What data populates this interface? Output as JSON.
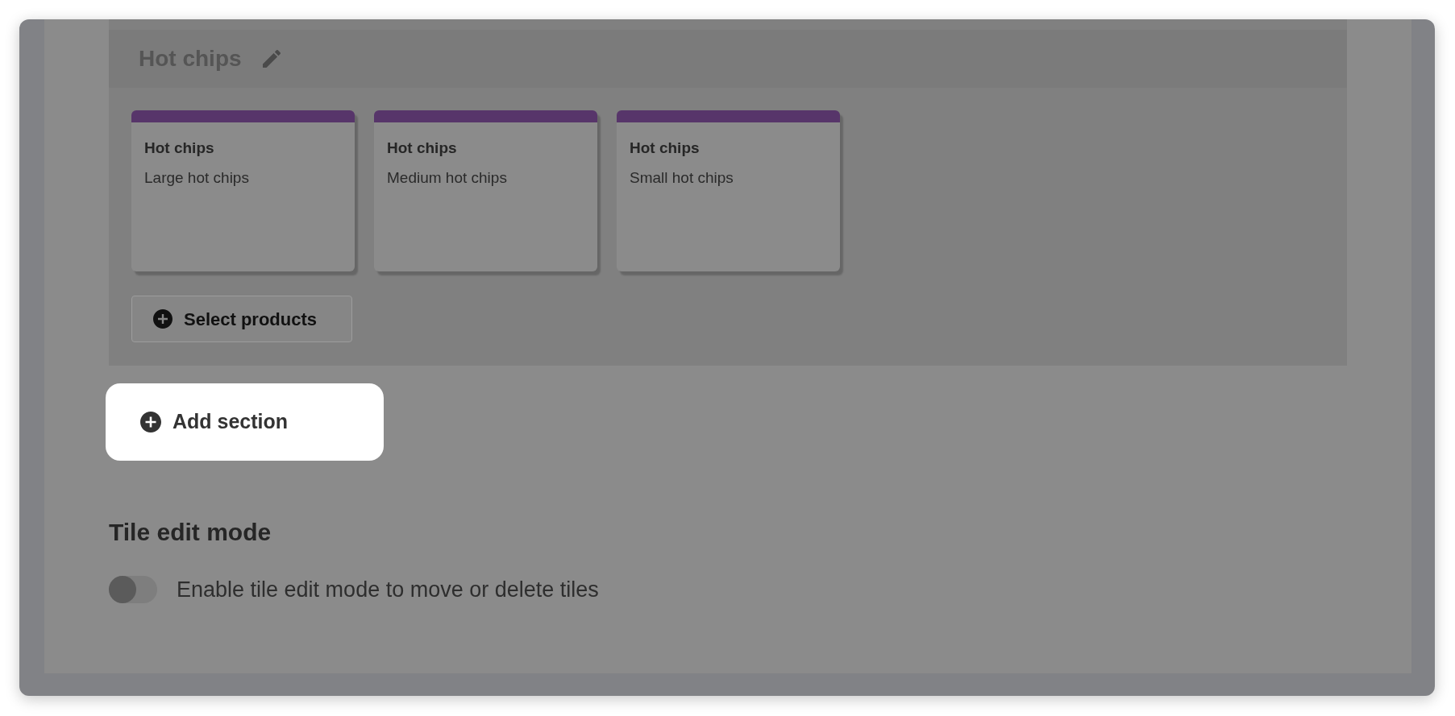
{
  "section": {
    "title": "Hot chips",
    "products": [
      {
        "name": "Hot chips",
        "variant": "Large hot chips"
      },
      {
        "name": "Hot chips",
        "variant": "Medium hot chips"
      },
      {
        "name": "Hot chips",
        "variant": "Small hot chips"
      }
    ],
    "select_button": "Select products"
  },
  "add_section_button": "Add section",
  "tile_edit_mode": {
    "heading": "Tile edit mode",
    "on": false,
    "description": "Enable tile edit mode to move or delete tiles"
  }
}
